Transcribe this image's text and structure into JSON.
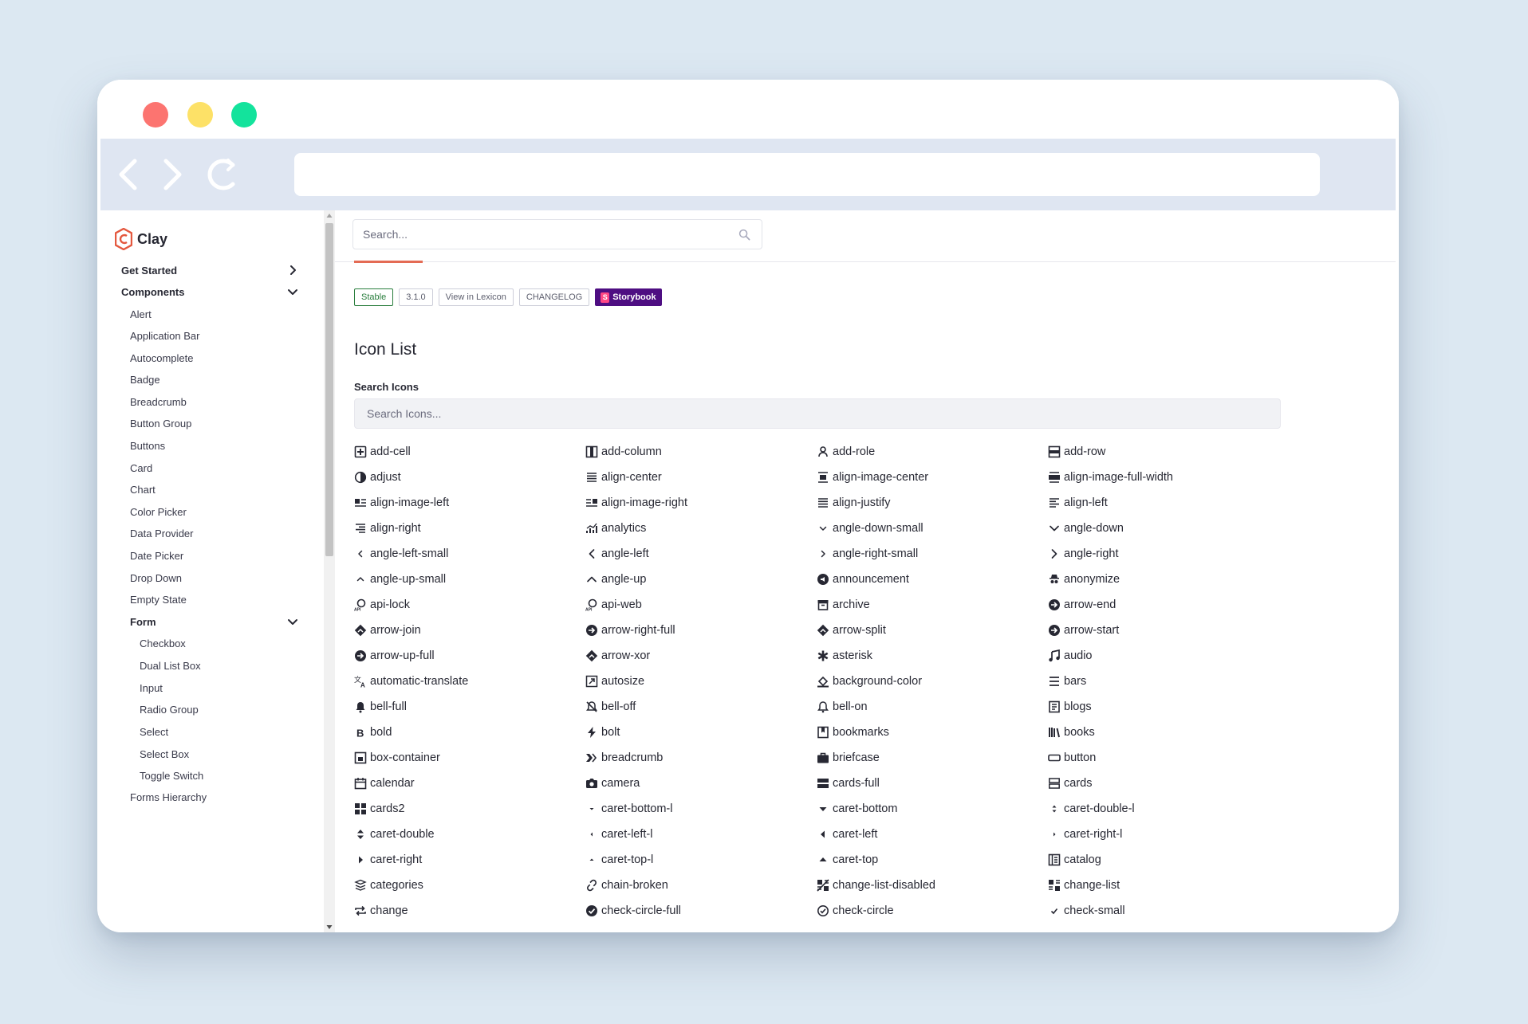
{
  "sidebar": {
    "logo_text": "Clay",
    "items": [
      {
        "label": "Get Started",
        "level": 0,
        "chevron": "right"
      },
      {
        "label": "Components",
        "level": 0,
        "chevron": "down"
      },
      {
        "label": "Alert",
        "level": 1
      },
      {
        "label": "Application Bar",
        "level": 1
      },
      {
        "label": "Autocomplete",
        "level": 1
      },
      {
        "label": "Badge",
        "level": 1
      },
      {
        "label": "Breadcrumb",
        "level": 1
      },
      {
        "label": "Button Group",
        "level": 1
      },
      {
        "label": "Buttons",
        "level": 1
      },
      {
        "label": "Card",
        "level": 1
      },
      {
        "label": "Chart",
        "level": 1
      },
      {
        "label": "Color Picker",
        "level": 1
      },
      {
        "label": "Data Provider",
        "level": 1
      },
      {
        "label": "Date Picker",
        "level": 1
      },
      {
        "label": "Drop Down",
        "level": 1
      },
      {
        "label": "Empty State",
        "level": 1
      },
      {
        "label": "Form",
        "level": 1,
        "chevron": "down"
      },
      {
        "label": "Checkbox",
        "level": 2
      },
      {
        "label": "Dual List Box",
        "level": 2
      },
      {
        "label": "Input",
        "level": 2
      },
      {
        "label": "Radio Group",
        "level": 2
      },
      {
        "label": "Select",
        "level": 2
      },
      {
        "label": "Select Box",
        "level": 2
      },
      {
        "label": "Toggle Switch",
        "level": 2
      },
      {
        "label": "Forms Hierarchy",
        "level": 1
      }
    ]
  },
  "header": {
    "search_placeholder": "Search..."
  },
  "badges": {
    "stable": "Stable",
    "version": "3.1.0",
    "lexicon": "View in Lexicon",
    "changelog": "CHANGELOG",
    "storybook": "Storybook",
    "storybook_logo": "S"
  },
  "page": {
    "title": "Icon List",
    "search_label": "Search Icons",
    "search_placeholder": "Search Icons..."
  },
  "icons": [
    "add-cell",
    "add-column",
    "add-role",
    "add-row",
    "adjust",
    "align-center",
    "align-image-center",
    "align-image-full-width",
    "align-image-left",
    "align-image-right",
    "align-justify",
    "align-left",
    "align-right",
    "analytics",
    "angle-down-small",
    "angle-down",
    "angle-left-small",
    "angle-left",
    "angle-right-small",
    "angle-right",
    "angle-up-small",
    "angle-up",
    "announcement",
    "anonymize",
    "api-lock",
    "api-web",
    "archive",
    "arrow-end",
    "arrow-join",
    "arrow-right-full",
    "arrow-split",
    "arrow-start",
    "arrow-up-full",
    "arrow-xor",
    "asterisk",
    "audio",
    "automatic-translate",
    "autosize",
    "background-color",
    "bars",
    "bell-full",
    "bell-off",
    "bell-on",
    "blogs",
    "bold",
    "bolt",
    "bookmarks",
    "books",
    "box-container",
    "breadcrumb",
    "briefcase",
    "button",
    "calendar",
    "camera",
    "cards-full",
    "cards",
    "cards2",
    "caret-bottom-l",
    "caret-bottom",
    "caret-double-l",
    "caret-double",
    "caret-left-l",
    "caret-left",
    "caret-right-l",
    "caret-right",
    "caret-top-l",
    "caret-top",
    "catalog",
    "categories",
    "chain-broken",
    "change-list-disabled",
    "change-list",
    "change",
    "check-circle-full",
    "check-circle",
    "check-small"
  ]
}
